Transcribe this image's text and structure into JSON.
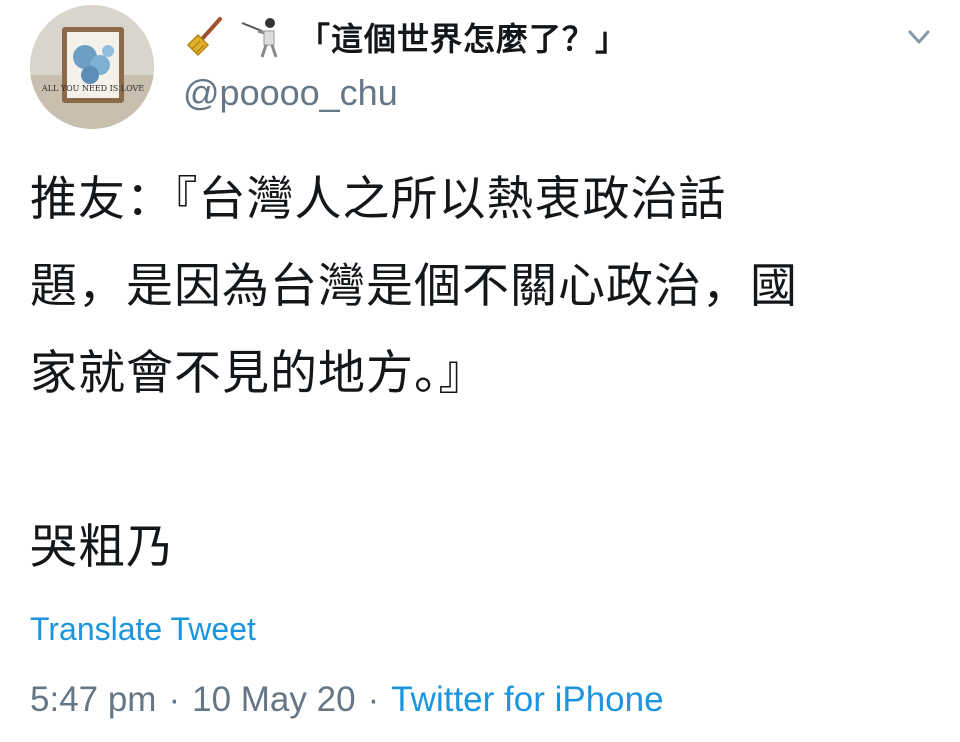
{
  "author": {
    "display_name": "「這個世界怎麼了？」",
    "handle": "@poooo_chu",
    "avatar_text": "ALL YOU NEED IS LOVE",
    "emoji_icons": [
      "broom-icon",
      "person-fencing-icon"
    ]
  },
  "tweet": {
    "lines": [
      "推友：『台灣人之所以熱衷政治話",
      "題，是因為台灣是個不關心政治，國",
      "家就會不見的地方。』",
      "",
      "哭粗乃"
    ],
    "translate_label": "Translate Tweet"
  },
  "meta": {
    "time": "5:47 pm",
    "separator": "·",
    "date": "10 May 20",
    "source": "Twitter for iPhone"
  },
  "colors": {
    "text": "#14171a",
    "secondary": "#657786",
    "link": "#1b95e0",
    "background": "#ffffff"
  },
  "icons": {
    "menu": "chevron-down-icon"
  }
}
